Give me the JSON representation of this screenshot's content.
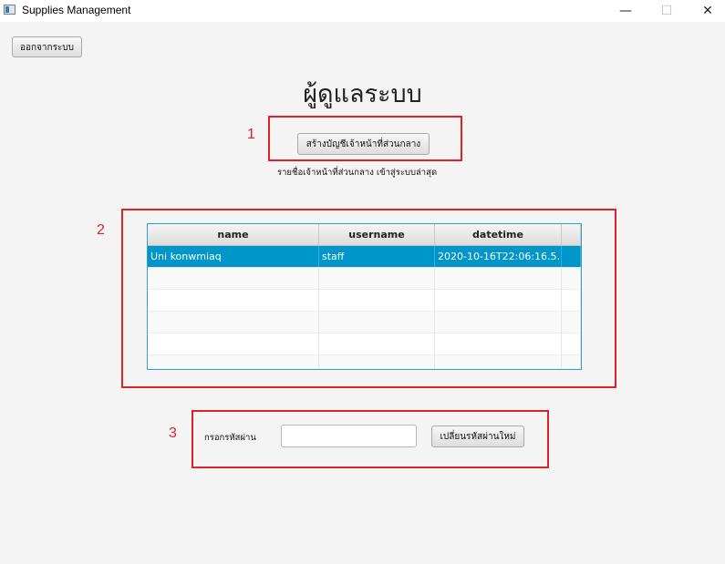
{
  "window": {
    "title": "Supplies Management",
    "minimize_glyph": "—",
    "maximize_glyph": "☐",
    "close_glyph": "✕"
  },
  "header": {
    "logout_label": "ออกจากระบบ",
    "title": "ผู้ดูแลระบบ"
  },
  "annotations": [
    "1",
    "2",
    "3"
  ],
  "section1": {
    "create_button": "สร้างบัญชีเจ้าหน้าที่ส่วนกลาง",
    "latest_label": "รายชื่อเจ้าหน้าที่ส่วนกลาง เข้าสู่ระบบล่าสุด"
  },
  "table": {
    "columns": [
      "name",
      "username",
      "datetime",
      ""
    ],
    "rows": [
      [
        "Uni konwmiaq",
        "staff",
        "2020-10-16T22:06:16.5...",
        ""
      ],
      [
        "",
        "",
        "",
        ""
      ],
      [
        "",
        "",
        "",
        ""
      ],
      [
        "",
        "",
        "",
        ""
      ],
      [
        "",
        "",
        "",
        ""
      ],
      [
        "",
        "",
        "",
        ""
      ]
    ],
    "selected_row": 0
  },
  "section3": {
    "password_label": "กรอกรหัสผ่าน",
    "password_value": "",
    "password_placeholder": "",
    "change_button": "เปลี่ยนรหัสผ่านใหม่"
  },
  "colors": {
    "annotation_red": "#e02127",
    "selection_blue": "#0096c9",
    "table_border": "#2aa0d6"
  }
}
